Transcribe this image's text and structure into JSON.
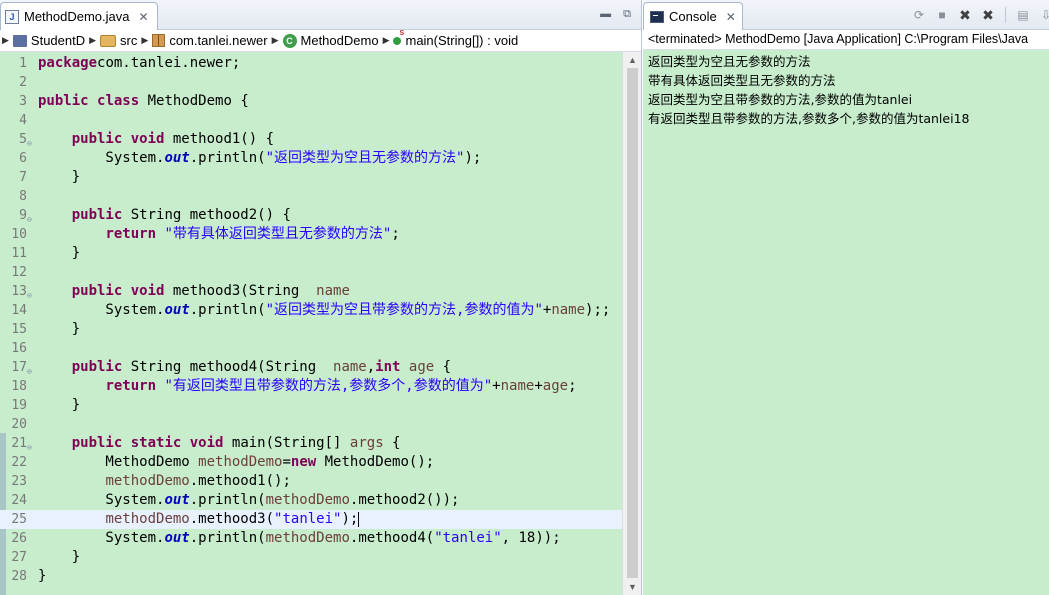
{
  "editor": {
    "tab_title": "MethodDemo.java",
    "tab_close": "✕",
    "minimize": "▬",
    "maximize": "⧉",
    "breadcrumb": [
      {
        "label": "StudentD",
        "icon": "project-icon"
      },
      {
        "label": "src",
        "icon": "source-folder-icon"
      },
      {
        "label": "com.tanlei.newer",
        "icon": "package-icon"
      },
      {
        "label": "MethodDemo",
        "icon": "class-icon"
      },
      {
        "label": "main(String[]) : void",
        "icon": "method-icon"
      }
    ],
    "lines": [
      {
        "n": "1",
        "fold": false,
        "tokens": [
          [
            "kw",
            "package"
          ],
          [
            "",
            "com.tanlei.newer;"
          ]
        ]
      },
      {
        "n": "2",
        "fold": false,
        "tokens": []
      },
      {
        "n": "3",
        "fold": false,
        "tokens": [
          [
            "kw",
            "public"
          ],
          [
            "",
            " "
          ],
          [
            "kw",
            "class"
          ],
          [
            "",
            " MethodDemo {"
          ]
        ]
      },
      {
        "n": "4",
        "fold": false,
        "tokens": []
      },
      {
        "n": "5",
        "fold": true,
        "tokens": [
          [
            "",
            "    "
          ],
          [
            "kw",
            "public"
          ],
          [
            "",
            " "
          ],
          [
            "kw",
            "void"
          ],
          [
            "",
            " methood1() {"
          ]
        ]
      },
      {
        "n": "6",
        "fold": false,
        "tokens": [
          [
            "",
            "        System."
          ],
          [
            "fld",
            "out"
          ],
          [
            "",
            ".println("
          ],
          [
            "str",
            "\"返回类型为空且无参数的方法\""
          ],
          [
            "",
            ");"
          ]
        ]
      },
      {
        "n": "7",
        "fold": false,
        "tokens": [
          [
            "",
            "    }"
          ]
        ]
      },
      {
        "n": "8",
        "fold": false,
        "tokens": []
      },
      {
        "n": "9",
        "fold": true,
        "tokens": [
          [
            "",
            "    "
          ],
          [
            "kw",
            "public"
          ],
          [
            "",
            " String methood2() {"
          ]
        ]
      },
      {
        "n": "10",
        "fold": false,
        "tokens": [
          [
            "",
            "        "
          ],
          [
            "kw",
            "return"
          ],
          [
            "",
            " "
          ],
          [
            "str",
            "\"带有具体返回类型且无参数的方法\""
          ],
          [
            "",
            ";"
          ]
        ]
      },
      {
        "n": "11",
        "fold": false,
        "tokens": [
          [
            "",
            "    }"
          ]
        ]
      },
      {
        "n": "12",
        "fold": false,
        "tokens": []
      },
      {
        "n": "13",
        "fold": true,
        "tokens": [
          [
            "",
            "    "
          ],
          [
            "kw",
            "public"
          ],
          [
            "",
            " "
          ],
          [
            "kw",
            "void"
          ],
          [
            "",
            " methood3(String  "
          ],
          [
            "var",
            "name"
          ],
          [
            ") {"
          ]
        ]
      },
      {
        "n": "14",
        "fold": false,
        "tokens": [
          [
            "",
            "        System."
          ],
          [
            "fld",
            "out"
          ],
          [
            "",
            ".println("
          ],
          [
            "str",
            "\"返回类型为空且带参数的方法,参数的值为\""
          ],
          [
            "",
            "+"
          ],
          [
            "var",
            "name"
          ],
          [
            "",
            ");;"
          ]
        ]
      },
      {
        "n": "15",
        "fold": false,
        "tokens": [
          [
            "",
            "    }"
          ]
        ]
      },
      {
        "n": "16",
        "fold": false,
        "tokens": []
      },
      {
        "n": "17",
        "fold": true,
        "tokens": [
          [
            "",
            "    "
          ],
          [
            "kw",
            "public"
          ],
          [
            "",
            " String methood4(String  "
          ],
          [
            "var",
            "name"
          ],
          [
            "",
            ","
          ],
          [
            "kw",
            "int"
          ],
          [
            "",
            " "
          ],
          [
            "var",
            "age"
          ],
          [
            "",
            " {"
          ]
        ]
      },
      {
        "n": "18",
        "fold": false,
        "tokens": [
          [
            "",
            "        "
          ],
          [
            "kw",
            "return"
          ],
          [
            "",
            " "
          ],
          [
            "str",
            "\"有返回类型且带参数的方法,参数多个,参数的值为\""
          ],
          [
            "",
            "+"
          ],
          [
            "var",
            "name"
          ],
          [
            "",
            "+"
          ],
          [
            "var",
            "age"
          ],
          [
            "",
            ";"
          ]
        ]
      },
      {
        "n": "19",
        "fold": false,
        "tokens": [
          [
            "",
            "    }"
          ]
        ]
      },
      {
        "n": "20",
        "fold": false,
        "tokens": []
      },
      {
        "n": "21",
        "fold": true,
        "tokens": [
          [
            "",
            "    "
          ],
          [
            "kw",
            "public"
          ],
          [
            "",
            " "
          ],
          [
            "kw",
            "static"
          ],
          [
            "",
            " "
          ],
          [
            "kw",
            "void"
          ],
          [
            "",
            " main(String[] "
          ],
          [
            "var",
            "args"
          ],
          [
            "",
            " {"
          ]
        ]
      },
      {
        "n": "22",
        "fold": false,
        "tokens": [
          [
            "",
            "        MethodDemo "
          ],
          [
            "var",
            "methodDemo"
          ],
          [
            "",
            "="
          ],
          [
            "kw",
            "new"
          ],
          [
            "",
            " MethodDemo();"
          ]
        ]
      },
      {
        "n": "23",
        "fold": false,
        "tokens": [
          [
            "",
            "        "
          ],
          [
            "var",
            "methodDemo"
          ],
          [
            "",
            ".methood1();"
          ]
        ]
      },
      {
        "n": "24",
        "fold": false,
        "tokens": [
          [
            "",
            "        System."
          ],
          [
            "fld",
            "out"
          ],
          [
            "",
            ".println("
          ],
          [
            "var",
            "methodDemo"
          ],
          [
            "",
            ".methood2());"
          ]
        ]
      },
      {
        "n": "25",
        "fold": false,
        "current": true,
        "tokens": [
          [
            "",
            "        "
          ],
          [
            "var",
            "methodDemo"
          ],
          [
            "",
            ".methood3("
          ],
          [
            "str",
            "\"tanlei\""
          ],
          [
            "",
            ");"
          ]
        ]
      },
      {
        "n": "26",
        "fold": false,
        "tokens": [
          [
            "",
            "        System."
          ],
          [
            "fld",
            "out"
          ],
          [
            "",
            ".println("
          ],
          [
            "var",
            "methodDemo"
          ],
          [
            "",
            ".methood4("
          ],
          [
            "str",
            "\"tanlei\""
          ],
          [
            "",
            ", 18));"
          ]
        ]
      },
      {
        "n": "27",
        "fold": false,
        "tokens": [
          [
            "",
            "    }"
          ]
        ]
      },
      {
        "n": "28",
        "fold": false,
        "tokens": [
          [
            "",
            "}"
          ]
        ]
      }
    ]
  },
  "console": {
    "tab_title": "Console",
    "tab_close": "✕",
    "header": "<terminated> MethodDemo [Java Application] C:\\Program Files\\Java",
    "output": [
      "返回类型为空且无参数的方法",
      "带有具体返回类型且无参数的方法",
      "返回类型为空且带参数的方法,参数的值为tanlei",
      "有返回类型且带参数的方法,参数多个,参数的值为tanlei18"
    ]
  }
}
